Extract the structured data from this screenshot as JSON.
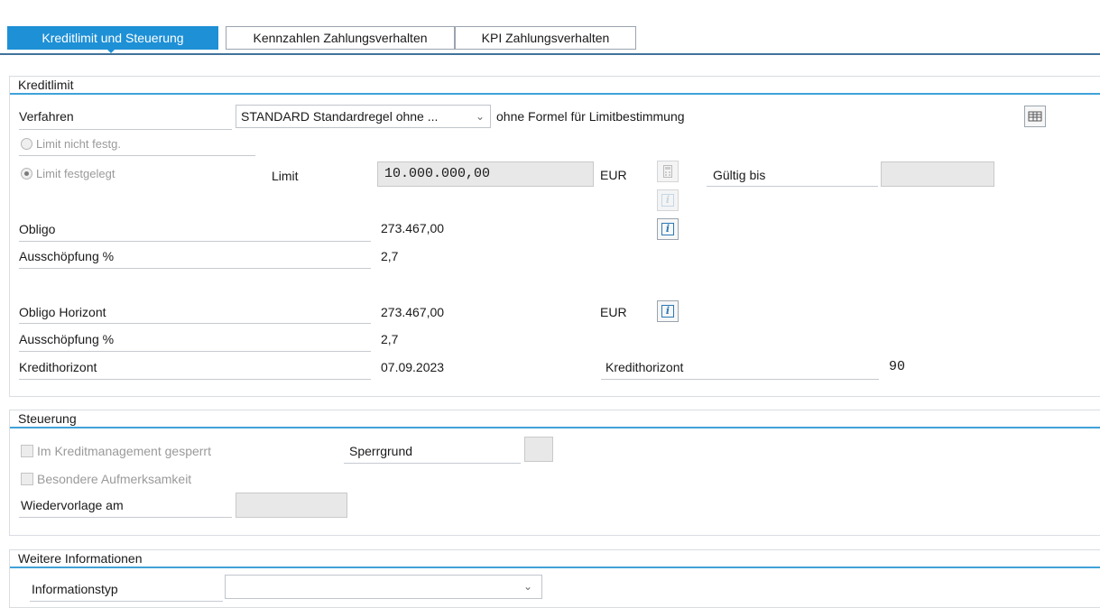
{
  "tabs": [
    {
      "label": "Kreditlimit und Steuerung",
      "active": true
    },
    {
      "label": "Kennzahlen Zahlungsverhalten",
      "active": false
    },
    {
      "label": "KPI Zahlungsverhalten",
      "active": false
    }
  ],
  "kreditlimit": {
    "title": "Kreditlimit",
    "verfahren_label": "Verfahren",
    "verfahren_value": "STANDARD Standardregel ohne ...",
    "verfahren_desc": "ohne Formel für Limitbestimmung",
    "radio_not_set": "Limit nicht festg.",
    "radio_set": "Limit  festgelegt",
    "limit_label": "Limit",
    "limit_value": "10.000.000,00",
    "limit_currency": "EUR",
    "gueltig_label": "Gültig bis",
    "gueltig_value": "",
    "obligo_label": "Obligo",
    "obligo_value": "273.467,00",
    "ausschoepfung_label": "Ausschöpfung %",
    "ausschoepfung_value": "2,7",
    "obligo_horizont_label": "Obligo Horizont",
    "obligo_horizont_value": "273.467,00",
    "obligo_horizont_currency": "EUR",
    "ausschoepfung2_label": "Ausschöpfung %",
    "ausschoepfung2_value": "2,7",
    "kredithorizont_label": "Kredithorizont",
    "kredithorizont_date": "07.09.2023",
    "kredithorizont_label2": "Kredithorizont",
    "kredithorizont_days": "90"
  },
  "steuerung": {
    "title": "Steuerung",
    "gesperrt_label": "Im Kreditmanagement gesperrt",
    "sperrgrund_label": "Sperrgrund",
    "sperrgrund_value": "",
    "aufmerksamkeit_label": "Besondere  Aufmerksamkeit",
    "wiedervorlage_label": "Wiedervorlage am",
    "wiedervorlage_value": ""
  },
  "weitere": {
    "title": "Weitere Informationen",
    "informationstyp_label": "Informationstyp",
    "informationstyp_value": ""
  },
  "icons": {
    "info": "i",
    "calculator": "calculator-icon",
    "table": "table-settings-icon"
  },
  "colors": {
    "accent": "#1e90d6",
    "tab_line": "#41729a",
    "group_line": "#41a2d8"
  }
}
